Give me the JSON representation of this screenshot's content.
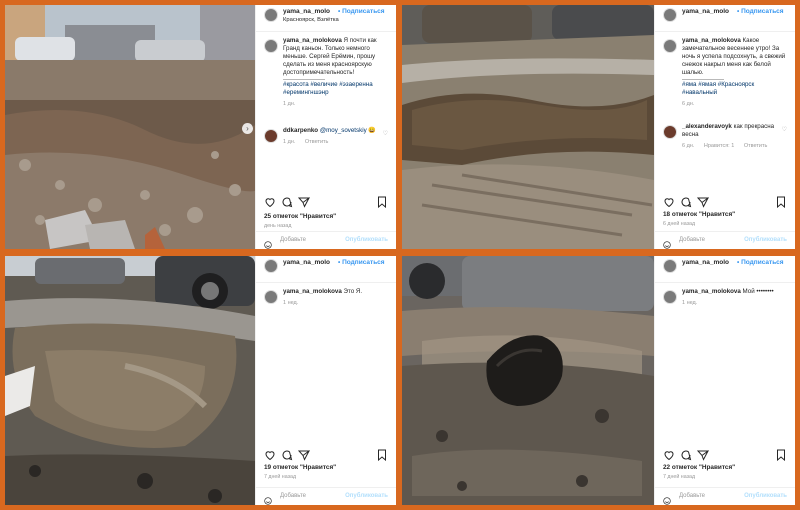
{
  "posts": [
    {
      "username": "yama_na_molo",
      "follow_label": "Подписаться",
      "location": "Красноярск, Взлётка",
      "caption_user": "yama_na_molokova",
      "caption_text": "Я почти как Гранд каньон. Только немного меньше. Сергей Ерёмин, прошу сделать из меня красноярскую достопримечательность!",
      "caption_tags": "#красота #величие #эзаеренна #еремингншэнр",
      "caption_time": "1 дн.",
      "comment_user": "ddkarpenko",
      "comment_mention": "@moy_sovetskiy",
      "comment_emoji": "😀",
      "comment_time": "1 дн.",
      "comment_reply": "Ответить",
      "likes": "25 отметок \"Нравится\"",
      "ago": "день назад",
      "add_comment": "Добавьте",
      "publish": "Опубликовать"
    },
    {
      "username": "yama_na_molo",
      "follow_label": "Подписаться",
      "caption_user": "yama_na_molokova",
      "caption_text": "Какое замечательное весеннее утро! За ночь я успела подсохнуть, а свежий снежок накрыл меня как белой шалью.",
      "caption_tags": "#яма #ямая #Красноярск #навальный",
      "caption_time": "6 дн.",
      "comment_user": "_alexanderavoyk",
      "comment_text": "как прекрасна весна",
      "comment_time": "6 дн.",
      "comment_likes": "Нравится: 1",
      "comment_reply": "Ответить",
      "likes": "18 отметок \"Нравится\"",
      "ago": "6 дней назад",
      "add_comment": "Добавьте",
      "publish": "Опубликовать"
    },
    {
      "username": "yama_na_molo",
      "follow_label": "Подписаться",
      "caption_user": "yama_na_molokova",
      "caption_text": "Это Я.",
      "caption_time": "1 нед.",
      "likes": "19 отметок \"Нравится\"",
      "ago": "7 дней назад",
      "add_comment": "Добавьте",
      "publish": "Опубликовать"
    },
    {
      "username": "yama_na_molo",
      "follow_label": "Подписаться",
      "caption_user": "yama_na_molokova",
      "caption_text": "Мой ••••••••",
      "caption_time": "1 нед.",
      "likes": "22 отметок \"Нравится\"",
      "ago": "7 дней назад",
      "add_comment": "Добавьте",
      "publish": "Опубликовать"
    }
  ],
  "icons": [
    "heart-icon",
    "comment-icon",
    "share-icon",
    "bookmark-icon",
    "smile-icon",
    "chevron-right-icon"
  ],
  "colors": {
    "frame": "#d8681f",
    "link": "#3897f0",
    "tag": "#003569",
    "muted": "#999999"
  }
}
